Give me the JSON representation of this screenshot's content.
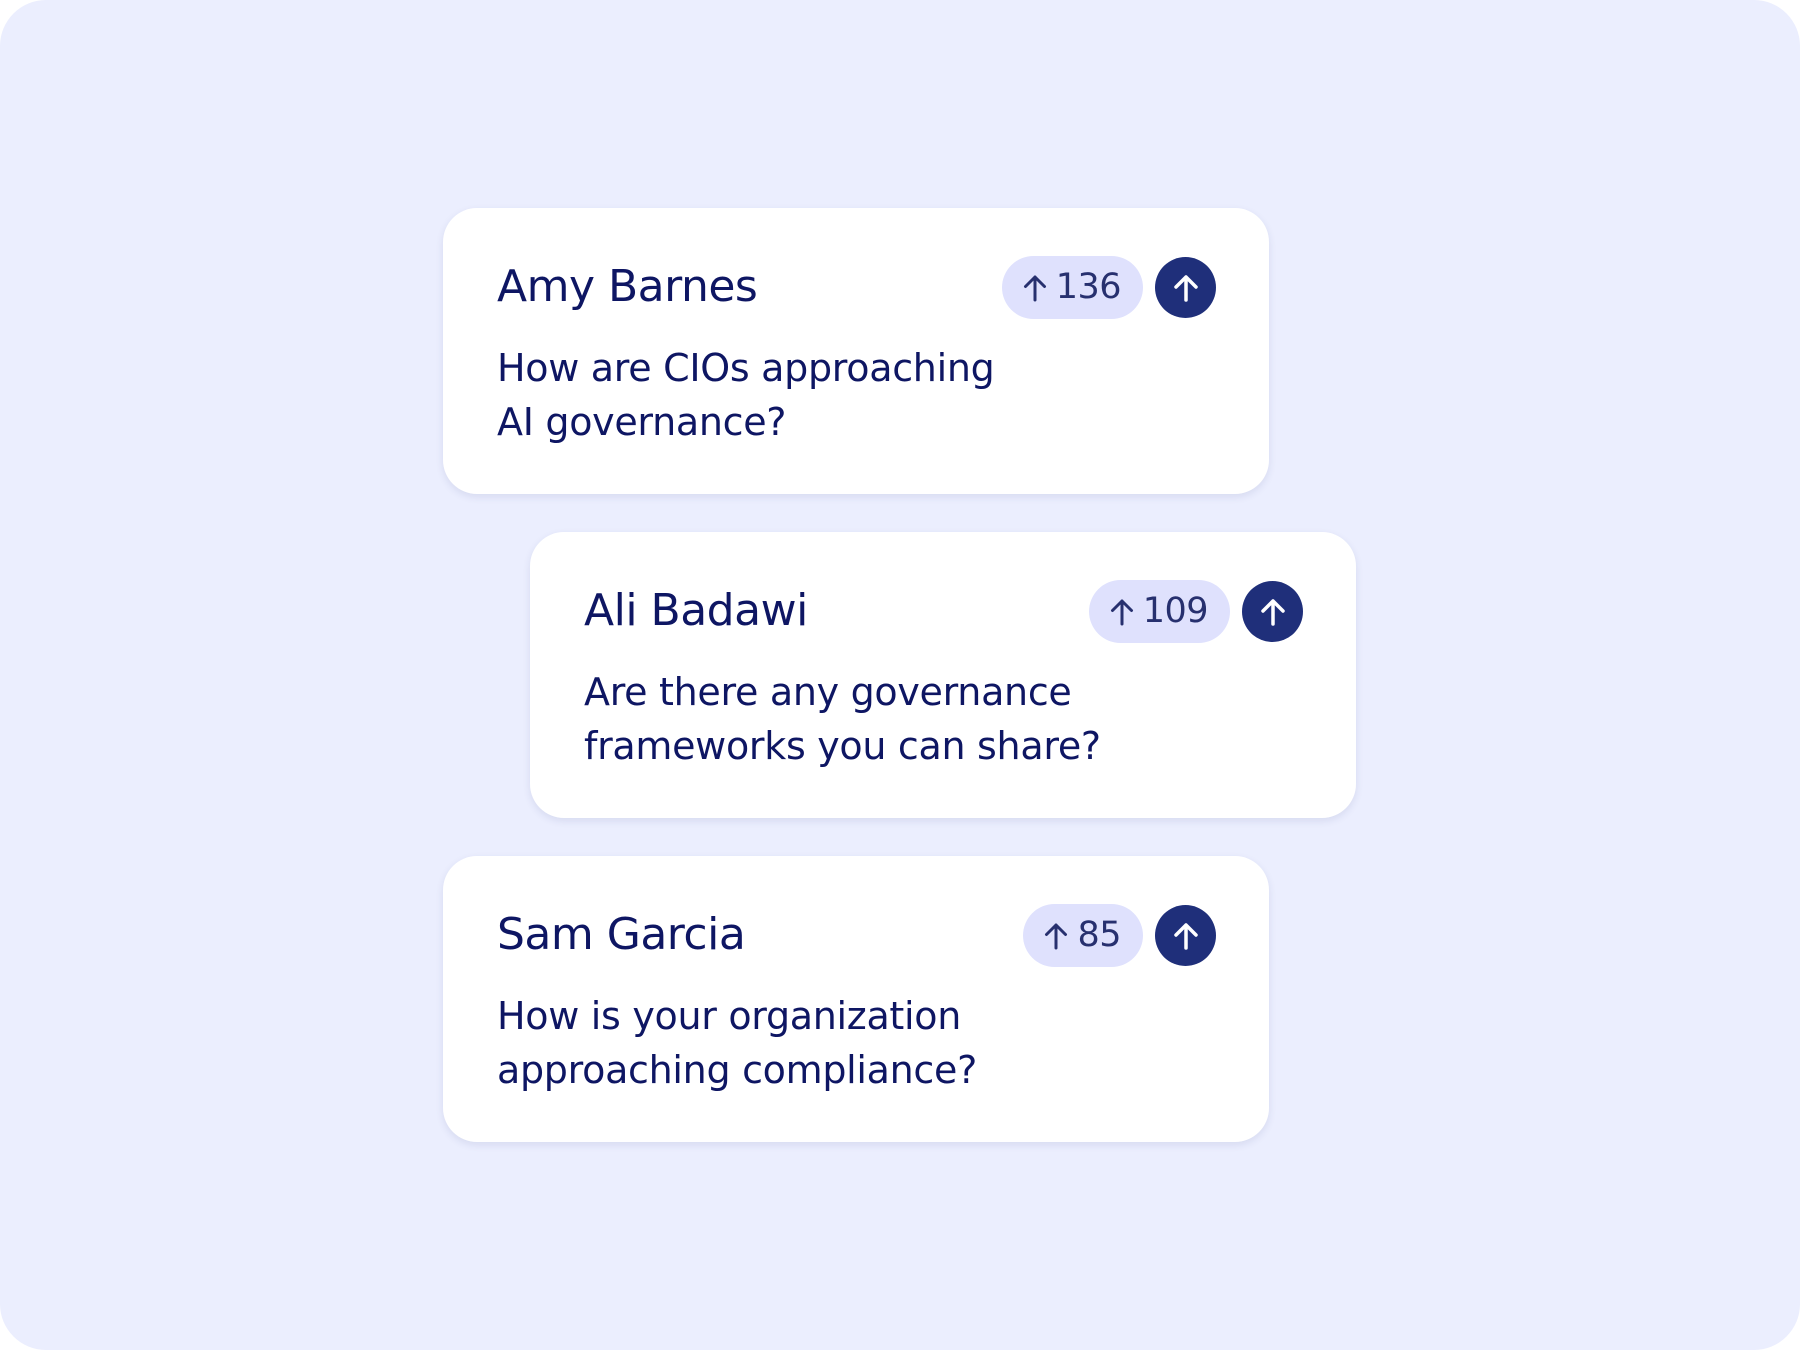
{
  "colors": {
    "background": "#ebeefe",
    "card": "#ffffff",
    "text": "#0e1663",
    "vote_pill": "#dfe1fd",
    "upvote_button": "#1f2f7a"
  },
  "icons": {
    "vote_count_icon": "arrow-up-icon",
    "upvote_button_icon": "arrow-up-icon"
  },
  "questions": [
    {
      "author": "Amy Barnes",
      "votes": "136",
      "text_line_1": "How are CIOs approaching",
      "text_line_2": "AI governance?"
    },
    {
      "author": "Ali Badawi",
      "votes": "109",
      "text_line_1": "Are there any governance",
      "text_line_2": "frameworks you can share?"
    },
    {
      "author": "Sam Garcia",
      "votes": "85",
      "text_line_1": "How is your organization",
      "text_line_2": "approaching compliance?"
    }
  ]
}
